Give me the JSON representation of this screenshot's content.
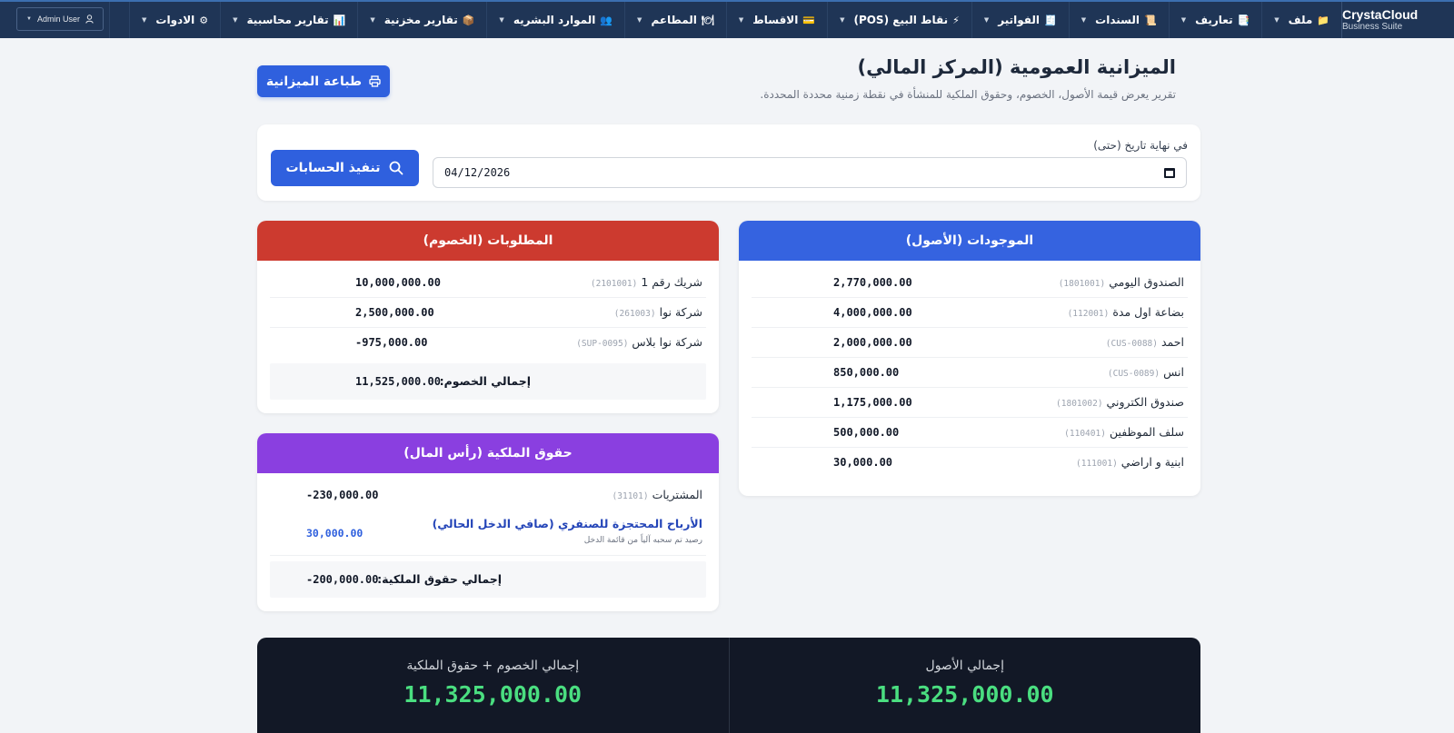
{
  "app": {
    "brand_name": "CrystaCloud",
    "brand_sub": "Business Suite",
    "user": "Admin User"
  },
  "menu": [
    {
      "label": "ملف",
      "icon": "📁",
      "icon_name": "folder-icon"
    },
    {
      "label": "تعاريف",
      "icon": "📑",
      "icon_name": "definitions-icon"
    },
    {
      "label": "السندات",
      "icon": "📜",
      "icon_name": "vouchers-icon"
    },
    {
      "label": "الفواتير",
      "icon": "🧾",
      "icon_name": "invoice-icon"
    },
    {
      "label": "نقاط البيع (POS)",
      "icon": "⚡",
      "icon_name": "lightning-icon"
    },
    {
      "label": "الاقساط",
      "icon": "💳",
      "icon_name": "card-icon"
    },
    {
      "label": "المطاعم",
      "icon": "🍽",
      "icon_name": "restaurant-icon"
    },
    {
      "label": "الموارد البشريه",
      "icon": "👥",
      "icon_name": "people-icon"
    },
    {
      "label": "تقارير مخزنية",
      "icon": "📦",
      "icon_name": "box-icon"
    },
    {
      "label": "تقارير محاسبية",
      "icon": "📊",
      "icon_name": "chart-icon"
    },
    {
      "label": "الادوات",
      "icon": "⚙",
      "icon_name": "gear-icon"
    }
  ],
  "page": {
    "title": "الميزانية العمومية (المركز المالي)",
    "subtitle": "تقرير يعرض قيمة الأصول، الخصوم، وحقوق الملكية للمنشأة في نقطة زمنية محددة المحددة.",
    "print_button": "طباعة الميزانية"
  },
  "filter": {
    "label": "في نهاية تاريخ (حتى)",
    "date_value": "04/12/2026",
    "execute_button": "تنفيذ الحسابات"
  },
  "assets": {
    "title": "الموجودات (الأصول)",
    "rows": [
      {
        "name": "الصندوق اليومي",
        "code": "(1801001)",
        "amount": "2,770,000.00"
      },
      {
        "name": "بضاعة اول مدة",
        "code": "(112001)",
        "amount": "4,000,000.00"
      },
      {
        "name": "احمد",
        "code": "(CUS-0088)",
        "amount": "2,000,000.00"
      },
      {
        "name": "انس",
        "code": "(CUS-0089)",
        "amount": "850,000.00"
      },
      {
        "name": "صندوق الكتروني",
        "code": "(1801002)",
        "amount": "1,175,000.00"
      },
      {
        "name": "سلف الموظفين",
        "code": "(110401)",
        "amount": "500,000.00"
      },
      {
        "name": "ابنية و اراضي",
        "code": "(111001)",
        "amount": "30,000.00"
      }
    ]
  },
  "liabilities": {
    "title": "المطلوبات (الخصوم)",
    "rows": [
      {
        "name": "شريك رقم 1",
        "code": "(2101001)",
        "amount": "10,000,000.00"
      },
      {
        "name": "شركة نوا",
        "code": "(261003)",
        "amount": "2,500,000.00"
      },
      {
        "name": "شركة نوا بلاس",
        "code": "(SUP-0095)",
        "amount": "-975,000.00"
      }
    ],
    "total_label": "إجمالي الخصوم:",
    "total_value": "11,525,000.00"
  },
  "equity": {
    "title": "حقوق الملكية (رأس المال)",
    "rows": [
      {
        "name": "المشتريات",
        "code": "(31101)",
        "amount": "-230,000.00"
      }
    ],
    "retained": {
      "title": "الأرباح المحتجزة للصنفري (صافي الدخل الحالي)",
      "note": "رصيد تم سحبه آلياً من قائمة الدخل",
      "amount": "30,000.00"
    },
    "total_label": "إجمالي حقوق الملكية:",
    "total_value": "-200,000.00"
  },
  "summary": {
    "assets_label": "إجمالي الأصول",
    "assets_value": "11,325,000.00",
    "liab_equity_label": "إجمالي الخصوم + حقوق الملكية",
    "liab_equity_value": "11,325,000.00"
  },
  "colors": {
    "topbar": "#1f3556",
    "primary": "#2f60de",
    "assets_header": "#3563e0",
    "liabilities_header": "#cc3a2f",
    "equity_header": "#8a3fe0",
    "summary_bg": "#121826",
    "summary_value": "#4ade80"
  }
}
